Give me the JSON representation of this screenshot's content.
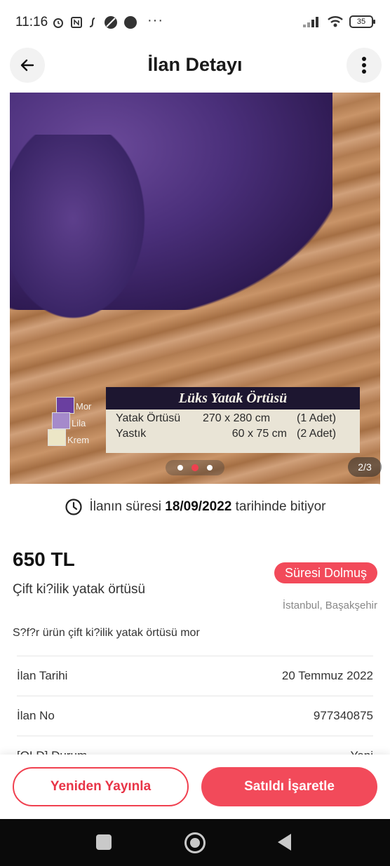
{
  "status_bar": {
    "time": "11:16",
    "more": "···",
    "battery": "35"
  },
  "header": {
    "title": "İlan Detayı"
  },
  "gallery": {
    "counter": "2/3",
    "photo_text": {
      "heading": "Lüks Yatak Örtüsü",
      "rows": [
        [
          "Yatak Örtüsü",
          "270 x 280 cm",
          "(1 Adet)"
        ],
        [
          "Yastık",
          "60 x 75 cm",
          "(2 Adet)"
        ]
      ],
      "swatches": [
        {
          "label": "Mor",
          "color": "#6a3fa0"
        },
        {
          "label": "Lila",
          "color": "#a58acb"
        },
        {
          "label": "Krem",
          "color": "#ece6c6"
        }
      ]
    }
  },
  "expiry": {
    "prefix": "İlanın süresi",
    "date": "18/09/2022",
    "suffix": "tarihinde bitiyor"
  },
  "listing": {
    "price": "650 TL",
    "status": "Süresi Dolmuş",
    "title": "Çift ki?ilik yatak örtüsü",
    "location": "İstanbul, Başakşehir",
    "description": "S?f?r ürün çift ki?ilik yatak örtüsü mor"
  },
  "details": [
    {
      "label": "İlan Tarihi",
      "value": "20 Temmuz 2022"
    },
    {
      "label": "İlan No",
      "value": "977340875"
    },
    {
      "label": "[OLD] Durum",
      "value": "Yeni"
    }
  ],
  "actions": {
    "republish": "Yeniden Yayınla",
    "mark_sold": "Satıldı İşaretle"
  },
  "colors": {
    "accent": "#f24a5a",
    "status_badge": "#f24a5a"
  }
}
